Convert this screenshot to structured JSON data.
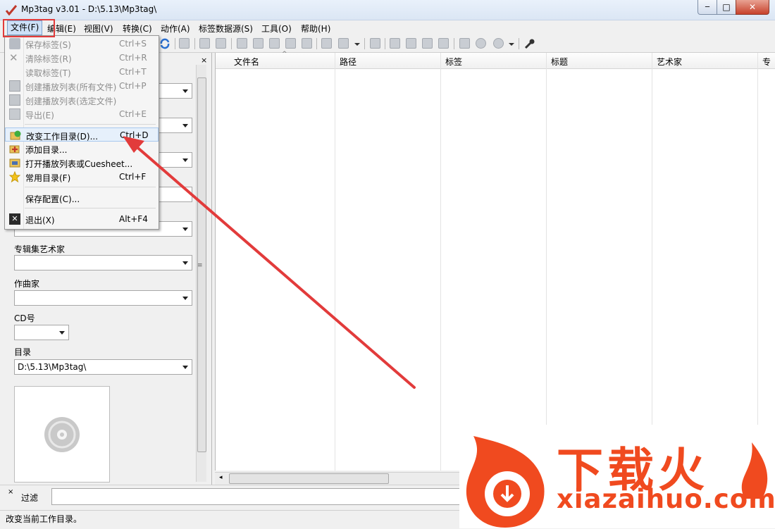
{
  "window": {
    "title": "Mp3tag v3.01  -  D:\\5.13\\Mp3tag\\",
    "minimize_glyph": "─",
    "maximize_glyph": "□",
    "close_glyph": "✕"
  },
  "menubar": {
    "items": [
      "文件(F)",
      "编辑(E)",
      "视图(V)",
      "转换(C)",
      "动作(A)",
      "标签数据源(S)",
      "工具(O)",
      "帮助(H)"
    ]
  },
  "file_menu": {
    "items": [
      {
        "label": "保存标签(S)",
        "shortcut": "Ctrl+S",
        "enabled": false,
        "icon": "save-icon"
      },
      {
        "label": "清除标签(R)",
        "shortcut": "Ctrl+R",
        "enabled": false,
        "icon": "remove-tag-icon"
      },
      {
        "label": "读取标签(T)",
        "shortcut": "Ctrl+T",
        "enabled": false,
        "icon": ""
      },
      {
        "label": "创建播放列表(所有文件)",
        "shortcut": "Ctrl+P",
        "enabled": false,
        "icon": "playlist-icon"
      },
      {
        "label": "创建播放列表(选定文件)",
        "shortcut": "",
        "enabled": false,
        "icon": "playlist-selected-icon"
      },
      {
        "label": "导出(E)",
        "shortcut": "Ctrl+E",
        "enabled": false,
        "icon": "export-icon"
      },
      {
        "label": "改变工作目录(D)...",
        "shortcut": "Ctrl+D",
        "enabled": true,
        "icon": "change-directory-icon"
      },
      {
        "label": "添加目录...",
        "shortcut": "",
        "enabled": true,
        "icon": "add-directory-icon"
      },
      {
        "label": "打开播放列表或Cuesheet...",
        "shortcut": "",
        "enabled": true,
        "icon": "open-playlist-icon"
      },
      {
        "label": "常用目录(F)",
        "shortcut": "Ctrl+F",
        "enabled": true,
        "icon": "favorite-star-icon"
      },
      {
        "label": "保存配置(C)...",
        "shortcut": "",
        "enabled": true,
        "icon": ""
      },
      {
        "label": "退出(X)",
        "shortcut": "Alt+F4",
        "enabled": true,
        "icon": "exit-icon"
      }
    ]
  },
  "left_panel": {
    "album_artist_label": "专辑集艺术家",
    "composer_label": "作曲家",
    "cd_label": "CD号",
    "directory_label": "目录",
    "directory_value": "D:\\5.13\\Mp3tag\\"
  },
  "grid": {
    "columns": [
      "文件名",
      "路径",
      "标签",
      "标题",
      "艺术家",
      "专"
    ]
  },
  "filter": {
    "label": "过滤"
  },
  "status": {
    "text": "改变当前工作目录。"
  },
  "watermark": {
    "brand_cn": "下载火",
    "brand_url": "xiazaihuo.com"
  },
  "colors": {
    "accent_red": "#e23b3b",
    "brand_orange": "#f04a1f",
    "menu_highlight": "#e6f0fb"
  }
}
